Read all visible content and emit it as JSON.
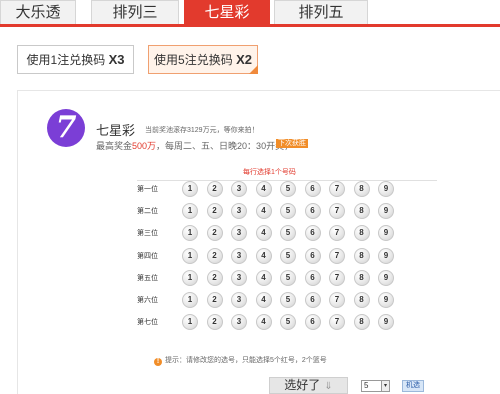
{
  "tabs": [
    "大乐透",
    "排列三",
    "七星彩",
    "排列五"
  ],
  "options": [
    {
      "label": "使用1注兑换码",
      "mult": "X3"
    },
    {
      "label": "使用5注兑换码",
      "mult": "X2"
    }
  ],
  "game": {
    "logo": "7",
    "title": "七星彩",
    "pool": "当前奖池滚存3129万元，等你来拍！",
    "line2_prefix": "最高奖金",
    "prize": "500万",
    "line2_suffix": "，每周二、五、日晚20：30开奖，",
    "badge": "下次获胜"
  },
  "grid": {
    "header": "每行选择1个号码",
    "rows": [
      "第一位",
      "第二位",
      "第三位",
      "第四位",
      "第五位",
      "第六位",
      "第七位"
    ],
    "numbers": [
      "1",
      "2",
      "3",
      "4",
      "5",
      "6",
      "7",
      "8",
      "9"
    ]
  },
  "tip": {
    "icon": "!",
    "text": "提示：请修改您的选号，只能选择5个红号，2个篮号"
  },
  "controls": {
    "pick": "选好了",
    "arrow": "⇓",
    "qty": "5",
    "caret": "▾",
    "random": "机选"
  }
}
